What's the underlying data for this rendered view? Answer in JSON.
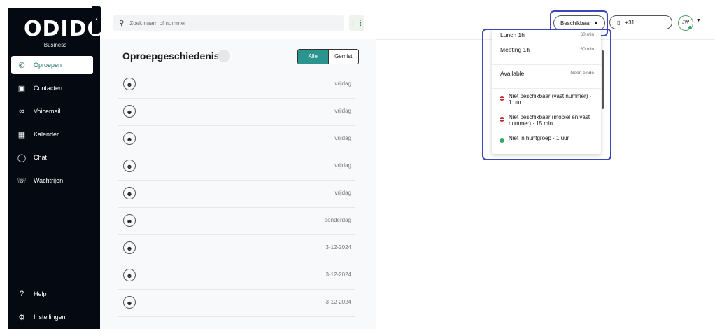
{
  "sidebar": {
    "logo_text": "ODIDO",
    "logo_sub": "Business",
    "collapse_icon": "chevron-left-icon",
    "items": [
      {
        "label": "Oproepen",
        "icon": "phone-icon",
        "active": true
      },
      {
        "label": "Contacten",
        "icon": "contact-card-icon",
        "active": false
      },
      {
        "label": "Voicemail",
        "icon": "voicemail-icon",
        "active": false
      },
      {
        "label": "Kalender",
        "icon": "calendar-icon",
        "active": false
      },
      {
        "label": "Chat",
        "icon": "chat-bubble-icon",
        "active": false
      },
      {
        "label": "Wachtrijen",
        "icon": "queue-phone-icon",
        "active": false
      }
    ],
    "bottom": [
      {
        "label": "Help",
        "icon": "help-circle-icon"
      },
      {
        "label": "Instellingen",
        "icon": "gear-icon"
      }
    ]
  },
  "topbar": {
    "search_placeholder": "Zoek naam of nummer",
    "status_label": "Beschikbaar",
    "phone_value": "+31",
    "avatar_initials": "JW"
  },
  "history": {
    "title": "Oproepgeschiedenis",
    "filter_all": "Alle",
    "filter_missed": "Gemist",
    "calls": [
      {
        "date": "vrijdag"
      },
      {
        "date": "vrijdag"
      },
      {
        "date": "vrijdag"
      },
      {
        "date": "vrijdag"
      },
      {
        "date": "vrijdag"
      },
      {
        "date": "donderdag"
      },
      {
        "date": "3-12-2024"
      },
      {
        "date": "3-12-2024"
      },
      {
        "date": "3-12-2024"
      }
    ]
  },
  "status_dropdown": {
    "options": [
      {
        "name": "Lunch 1h",
        "meta": "60 min"
      },
      {
        "name": "Meeting 1h",
        "meta": "60 min"
      },
      {
        "name": "Available",
        "meta": "Geen einde"
      }
    ],
    "statuses": [
      {
        "text": "Niet beschikbaar (vast nummer) · 1 uur",
        "color": "#c1272d"
      },
      {
        "text": "Niet beschikbaar (mobiel en vast nummer) · 15 min",
        "color": "#c1272d"
      },
      {
        "text": "Niet in huntgroep · 1 uur",
        "color": "#2eaa5e"
      }
    ]
  },
  "colors": {
    "accent": "#2b948e",
    "highlight": "#3b49b8",
    "sidebar_bg": "#050a12"
  }
}
